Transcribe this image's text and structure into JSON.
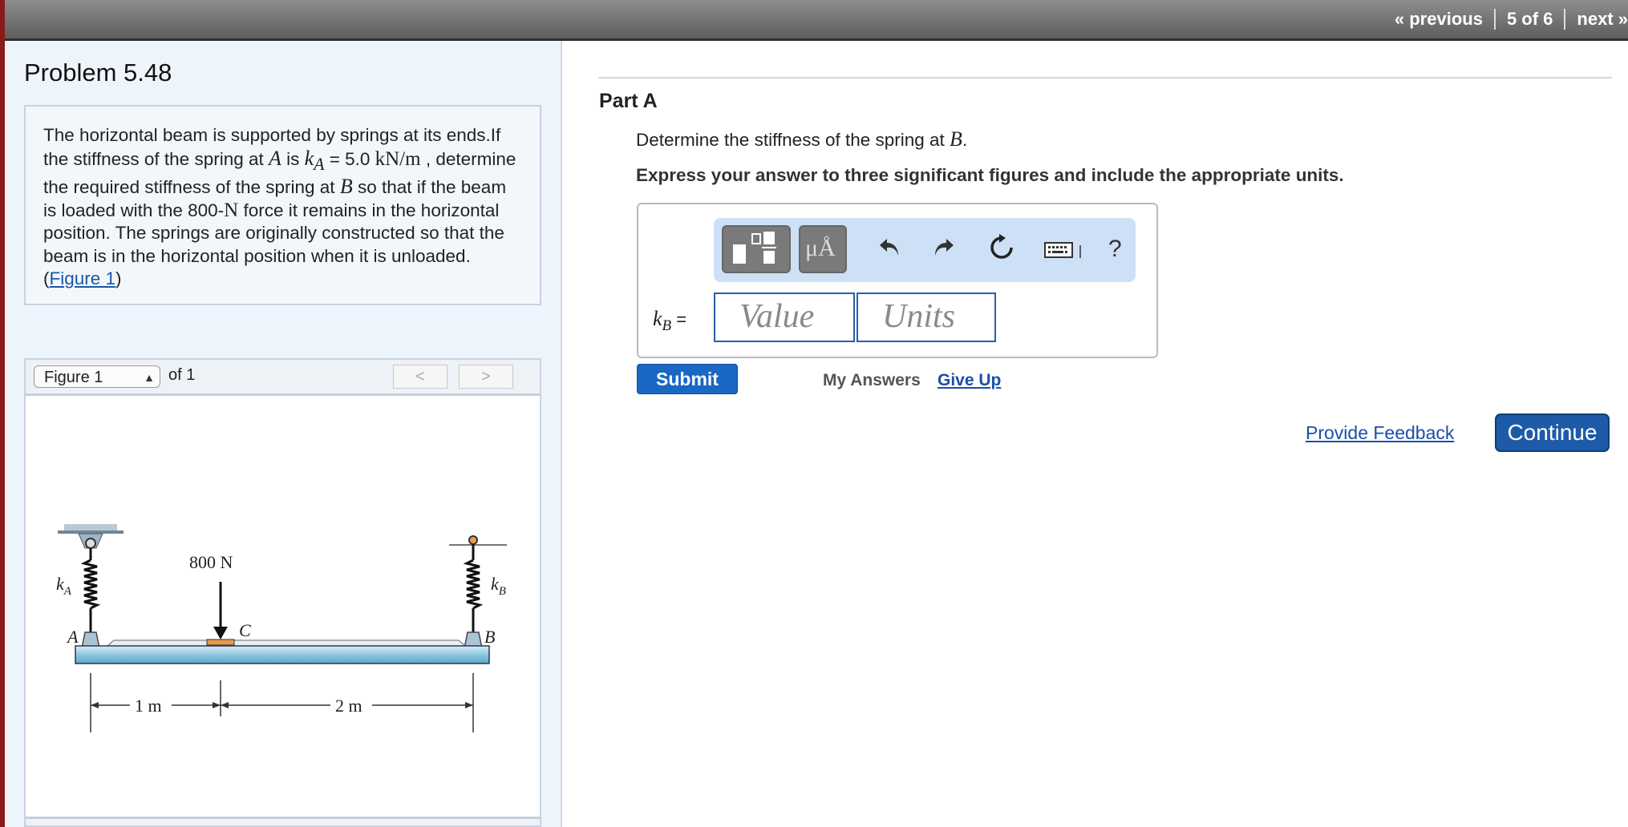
{
  "nav": {
    "previous": "« previous",
    "position": "5 of 6",
    "next": "next »"
  },
  "problem": {
    "title": "Problem 5.48",
    "text_1": "The horizontal beam is supported by springs at its ends.If the stiffness of the spring at ",
    "sym_A": "A",
    "text_2": " is ",
    "sym_kA": "k",
    "sub_A": "A",
    "text_3": " = 5.0 ",
    "unit_kNm": "kN/m",
    "text_4": " , determine the required stiffness of the spring at ",
    "sym_B": "B",
    "text_5": " so that if the beam is loaded with the 800-",
    "unit_N": "N",
    "text_6": " force it remains in the horizontal position. The springs are originally constructed so that the beam is in the horizontal position when it is unloaded. (",
    "figure_link": "Figure 1",
    "text_7": ")"
  },
  "figure": {
    "select_value": "Figure 1",
    "of_label": "of 1",
    "prev": "<",
    "next": ">",
    "labels": {
      "force": "800 N",
      "kA": "k",
      "kA_sub": "A",
      "kB": "k",
      "kB_sub": "B",
      "A": "A",
      "B": "B",
      "C": "C",
      "dim1": "1 m",
      "dim2": "2 m"
    }
  },
  "part": {
    "title": "Part A",
    "question_1": "Determine the stiffness of the spring at ",
    "question_sym": "B",
    "question_end": ".",
    "instruction": "Express your answer to three significant figures and include the appropriate units."
  },
  "toolbar": {
    "units_btn": "μÅ",
    "help": "?"
  },
  "answer": {
    "var": "k",
    "var_sub": "B",
    "eq": " =",
    "value_placeholder": "Value",
    "units_placeholder": "Units"
  },
  "actions": {
    "submit": "Submit",
    "my_answers": "My Answers",
    "give_up": "Give Up",
    "feedback": "Provide Feedback",
    "continue": "Continue"
  }
}
